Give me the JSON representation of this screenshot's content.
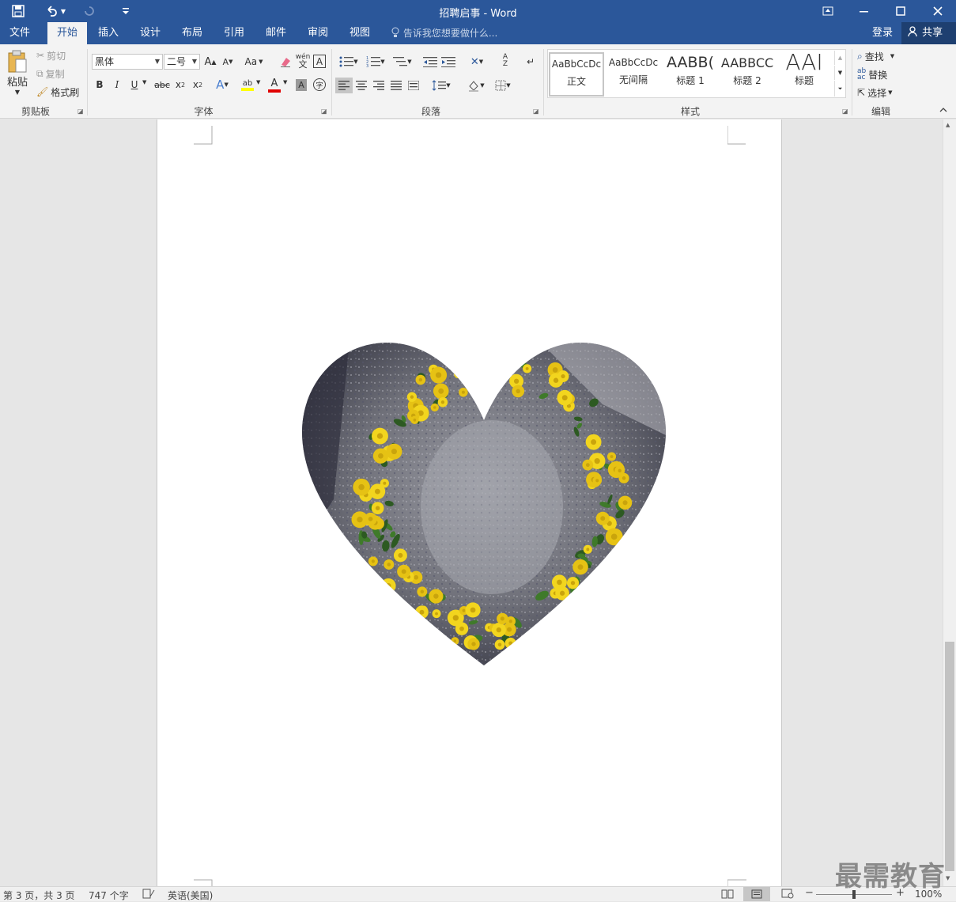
{
  "window": {
    "title": "招聘启事 - Word"
  },
  "tabs": [
    "文件",
    "开始",
    "插入",
    "设计",
    "布局",
    "引用",
    "邮件",
    "审阅",
    "视图"
  ],
  "active_tab": "开始",
  "tellme": {
    "placeholder": "告诉我您想要做什么..."
  },
  "account": {
    "login": "登录",
    "share": "共享"
  },
  "clipboard": {
    "paste": "粘贴",
    "cut": "剪切",
    "copy": "复制",
    "format_painter": "格式刷",
    "label": "剪贴板"
  },
  "font": {
    "name": "黑体",
    "size": "二号",
    "case_btn": "Aa",
    "label": "字体",
    "highlight_color": "#ffff00",
    "font_color": "#e00000"
  },
  "paragraph": {
    "label": "段落"
  },
  "styles": {
    "items": [
      {
        "preview": "AaBbCcDc",
        "name": "正文"
      },
      {
        "preview": "AaBbCcDc",
        "name": "无间隔"
      },
      {
        "preview": "AABB(",
        "name": "标题 1"
      },
      {
        "preview": "AABBCC",
        "name": "标题 2"
      },
      {
        "preview": "AAI",
        "name": "标题"
      }
    ],
    "label": "样式"
  },
  "editing": {
    "find": "查找",
    "replace": "替换",
    "select": "选择",
    "label": "编辑"
  },
  "status": {
    "page": "第 3 页，共 3 页",
    "words": "747 个字",
    "language": "英语(美国)",
    "zoom": "100%",
    "zoom_level": 1.0
  },
  "watermark": "最需教育",
  "colors": {
    "accent": "#2b579a"
  }
}
